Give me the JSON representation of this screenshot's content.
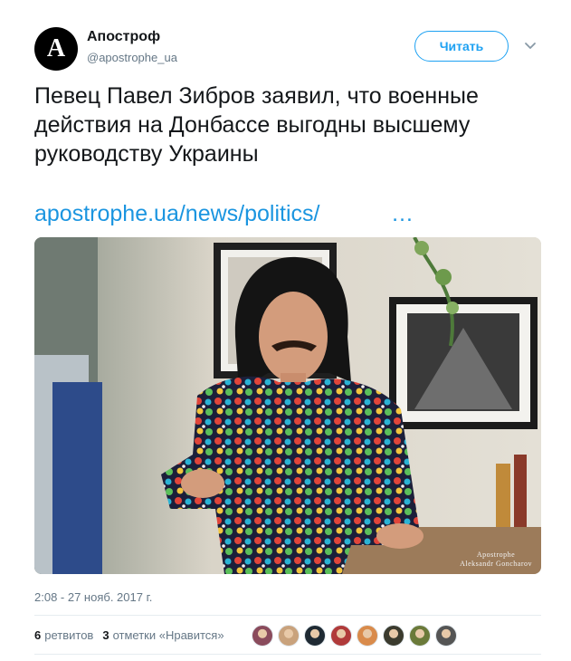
{
  "header": {
    "avatar_logo": "A",
    "name": "Апостроф",
    "handle": "@apostrophe_ua",
    "follow_label": "Читать",
    "menu_icon": "chevron-down-icon"
  },
  "tweet": {
    "text": "Певец Павел Зибров заявил, что военные действия на Донбассе выгодны высшему руководству Украины",
    "link": "apostrophe.ua/news/politics/",
    "link_ellipsis": "…",
    "photo_watermark": [
      "Apostrophe",
      "Aleksandr Goncharov"
    ],
    "timestamp": "2:08 - 27 нояб. 2017 г."
  },
  "stats": {
    "retweets_count": "6",
    "retweets_label": "ретвитов",
    "likes_count": "3",
    "likes_label": "отметки «Нравится»"
  },
  "likers": [
    {
      "color": "#8a4b5c"
    },
    {
      "color": "#c9a27c"
    },
    {
      "color": "#1f2a33"
    },
    {
      "color": "#b03a3a"
    },
    {
      "color": "#d98b4b"
    },
    {
      "color": "#3b3b2e"
    },
    {
      "color": "#6b7a3a"
    },
    {
      "color": "#555555"
    }
  ],
  "colors": {
    "accent": "#1da1f2",
    "link": "#1b95e0",
    "muted": "#657786",
    "text": "#14171a"
  }
}
